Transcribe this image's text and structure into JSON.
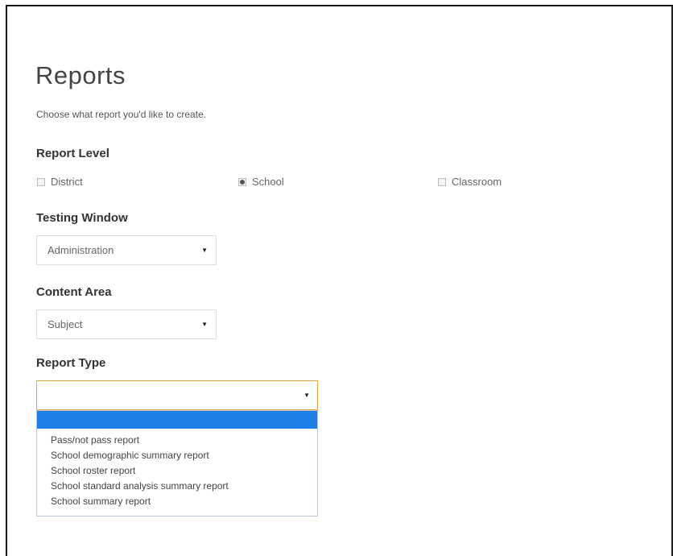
{
  "page": {
    "title": "Reports",
    "subtitle": "Choose what report you'd like to create."
  },
  "report_level": {
    "label": "Report Level",
    "options": [
      {
        "label": "District",
        "selected": false
      },
      {
        "label": "School",
        "selected": true
      },
      {
        "label": "Classroom",
        "selected": false
      }
    ]
  },
  "testing_window": {
    "label": "Testing Window",
    "selected": "Administration"
  },
  "content_area": {
    "label": "Content Area",
    "selected": "Subject"
  },
  "report_type": {
    "label": "Report Type",
    "selected": "",
    "options": [
      "",
      "Pass/not pass report",
      "School demographic summary report",
      "School roster report",
      "School standard analysis summary report",
      "School summary report"
    ]
  },
  "colors": {
    "focus_border": "#e8a642",
    "highlight": "#1e7fe6"
  },
  "icons": {
    "select_caret": "caret-down-icon"
  }
}
